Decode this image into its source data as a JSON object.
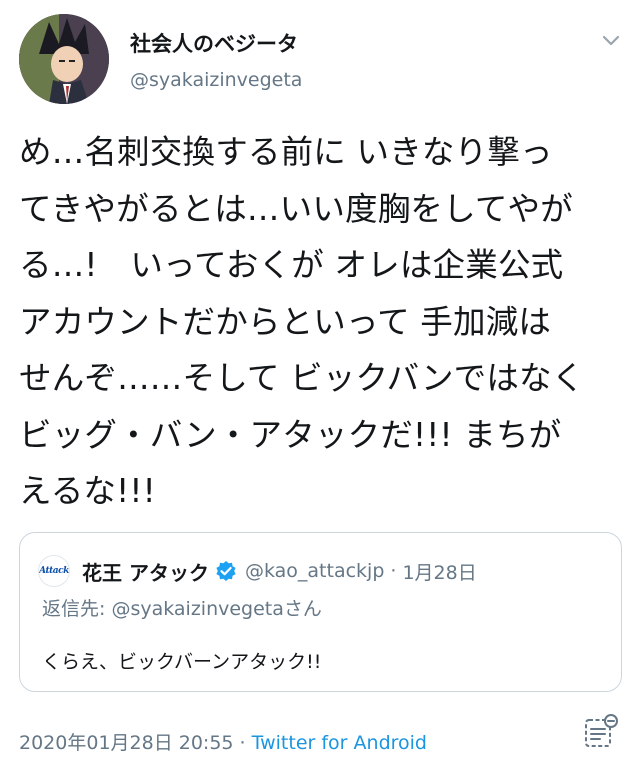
{
  "author": {
    "display_name": "社会人のベジータ",
    "handle": "@syakaizinvegeta"
  },
  "tweet": {
    "lines": [
      "め…名刺交換する前に いきなり撃っ",
      "てきやがるとは…いい度胸をしてやが",
      "る…!　いっておくが オレは企業公式",
      "アカウントだからといって 手加減は",
      "せんぞ……そして ビックバンではなく",
      "ビッグ・バン・アタックだ!!! まちが",
      "えるな!!!"
    ]
  },
  "quote": {
    "logo_text": "Attack",
    "name": "花王 アタック",
    "handle": "@kao_attackjp",
    "separator": "·",
    "date": "1月28日",
    "reply_prefix": "返信先: ",
    "reply_to": "@syakaizinvegeta",
    "reply_suffix": "さん",
    "body": "くらえ、ビックバーンアタック!!"
  },
  "footer": {
    "timestamp": "2020年01月28日 20:55",
    "separator": " · ",
    "source": "Twitter for Android"
  },
  "icons": {
    "caret": "chevron-down-icon",
    "verified": "verified-badge-icon",
    "footer": "tweet-details-icon"
  },
  "colors": {
    "text": "#14171a",
    "secondary": "#657786",
    "link": "#1b95e0",
    "verified": "#1da1f2",
    "border": "#ccd6dd"
  }
}
